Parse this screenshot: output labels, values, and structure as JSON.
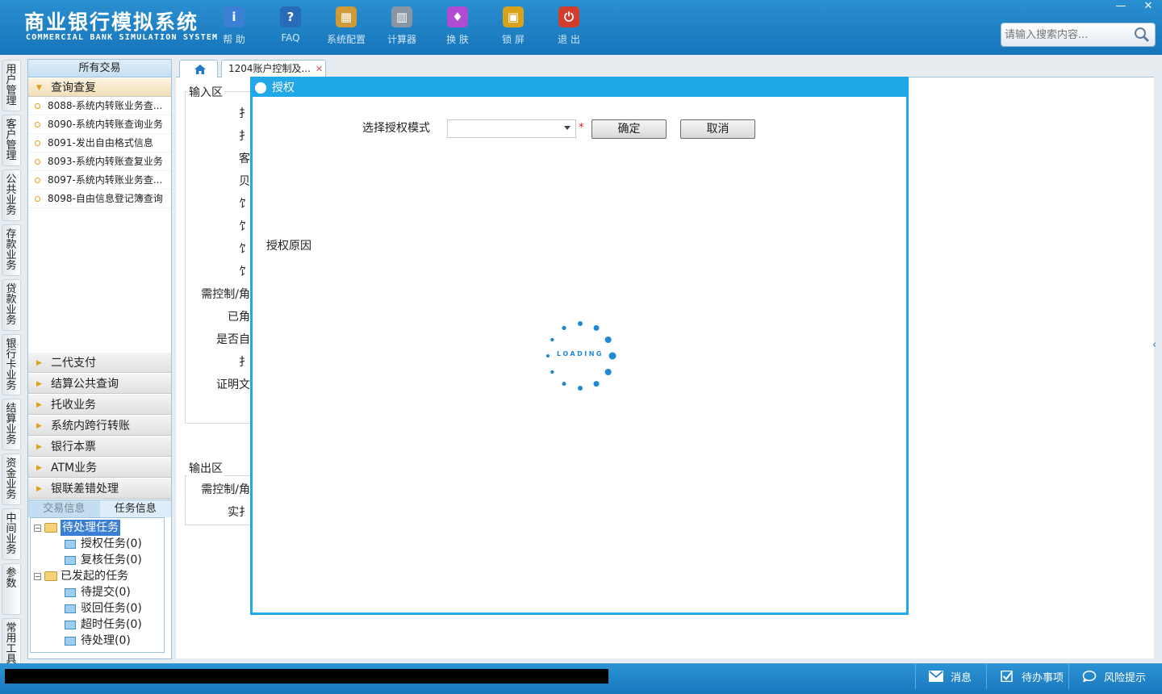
{
  "app": {
    "title_cn": "商业银行模拟系统",
    "title_en": "COMMERCIAL BANK SIMULATION SYSTEM"
  },
  "toolbar": [
    {
      "label": "帮 助",
      "icon": "help-icon",
      "glyph": "i",
      "color": "#3e7fd6"
    },
    {
      "label": "FAQ",
      "icon": "faq-icon",
      "glyph": "?",
      "color": "#2a6bb8"
    },
    {
      "label": "系统配置",
      "icon": "toolbox-icon",
      "glyph": "▦",
      "color": "#d19a38"
    },
    {
      "label": "计算器",
      "icon": "calculator-icon",
      "glyph": "▥",
      "color": "#8896a4"
    },
    {
      "label": "换 肤",
      "icon": "tshirt-icon",
      "glyph": "♦",
      "color": "#b24bd3"
    },
    {
      "label": "锁 屏",
      "icon": "lock-icon",
      "glyph": "▣",
      "color": "#d9a21c"
    },
    {
      "label": "退 出",
      "icon": "power-icon",
      "glyph": "⏻",
      "color": "#d23d2e"
    }
  ],
  "search": {
    "placeholder": "请输入搜索内容..."
  },
  "window_controls": {
    "minimize": "—",
    "close": "✕"
  },
  "left_nav": [
    "用户管理",
    "客户管理",
    "公共业务",
    "存款业务",
    "贷款业务",
    "银行卡业务",
    "结算业务",
    "资金业务",
    "中间业务",
    "参数",
    "常用工具"
  ],
  "trade_menu": {
    "header": "所有交易",
    "open_group": "查询查复",
    "open_items": [
      "8088-系统内转账业务查...",
      "8090-系统内转账查询业务",
      "8091-发出自由格式信息",
      "8093-系统内转账查复业务",
      "8097-系统内转账业务查...",
      "8098-自由信息登记簿查询"
    ],
    "groups": [
      "二代支付",
      "结算公共查询",
      "托收业务",
      "系统内跨行转账",
      "银行本票",
      "ATM业务",
      "银联差错处理"
    ]
  },
  "info_tabs": {
    "tab1": "交易信息",
    "tab2": "任务信息"
  },
  "task_tree": {
    "pending": "待处理任务",
    "pending_children": [
      "授权任务(0)",
      "复核任务(0)"
    ],
    "initiated": "已发起的任务",
    "initiated_children": [
      "待提交(0)",
      "驳回任务(0)",
      "超时任务(0)",
      "待处理(0)"
    ]
  },
  "tabs": {
    "current": "1204账户控制及...",
    "close": "✕"
  },
  "form": {
    "input_legend": "输入区",
    "output_legend": "输出区",
    "input_labels": [
      "扌",
      "扌",
      "客",
      "贝",
      "饣",
      "饣",
      "饣",
      "饣",
      "需控制/角",
      "已角",
      "是否自",
      "扌",
      "证明文"
    ],
    "output_labels": [
      "需控制/角",
      "实扌"
    ]
  },
  "dialog": {
    "title": "授权",
    "mode_label": "选择授权模式",
    "mode_value": "",
    "required_mark": "*",
    "confirm": "确定",
    "cancel": "取消",
    "reason_label": "授权原因",
    "loading_text": "LOADING"
  },
  "statusbar": {
    "messages": "消息",
    "todo": "待办事项",
    "risk": "风险提示"
  }
}
